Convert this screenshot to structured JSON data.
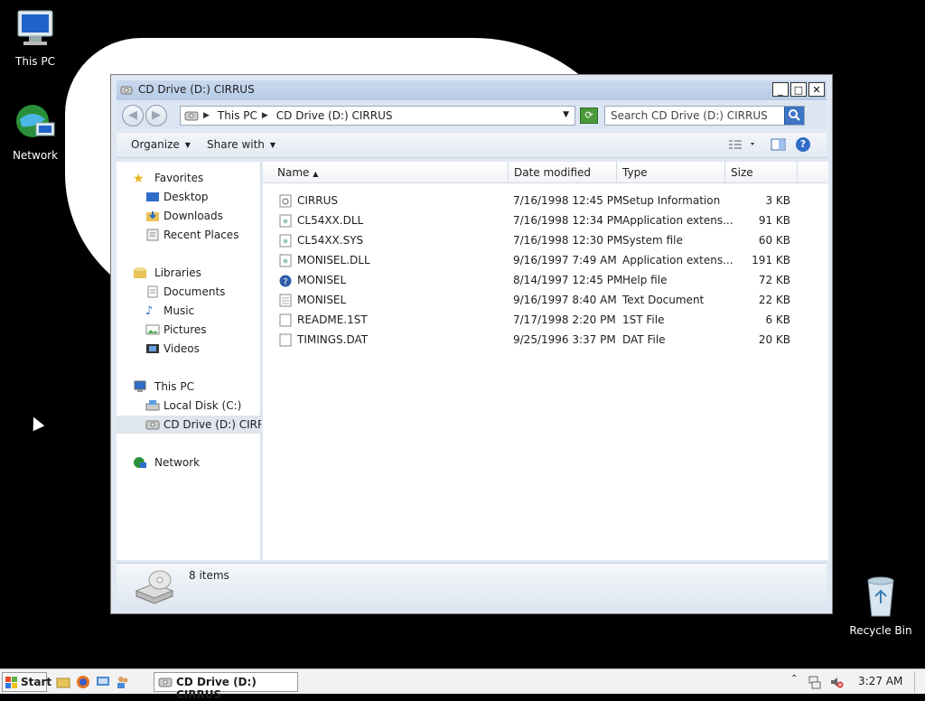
{
  "desktop": {
    "icons": [
      {
        "label": "This PC",
        "icon": "computer-icon"
      },
      {
        "label": "Network",
        "icon": "network-globe-icon"
      },
      {
        "label": "Recycle Bin",
        "icon": "recycle-bin-icon"
      }
    ]
  },
  "window": {
    "title": "CD Drive (D:) CIRRUS",
    "controls": {
      "minimize": "_",
      "maximize": "□",
      "close": "✕"
    },
    "address": {
      "crumbs": [
        "This PC",
        "CD Drive (D:) CIRRUS"
      ]
    },
    "search_placeholder": "Search CD Drive (D:) CIRRUS",
    "toolbar": {
      "organize": "Organize",
      "share_with": "Share with"
    },
    "nav": {
      "favorites": "Favorites",
      "favorites_items": [
        "Desktop",
        "Downloads",
        "Recent Places"
      ],
      "libraries": "Libraries",
      "libraries_items": [
        "Documents",
        "Music",
        "Pictures",
        "Videos"
      ],
      "thispc": "This PC",
      "thispc_items": [
        "Local Disk (C:)",
        "CD Drive (D:) CIRRUS"
      ],
      "network": "Network"
    },
    "columns": [
      "Name",
      "Date modified",
      "Type",
      "Size"
    ],
    "files": [
      {
        "name": "CIRRUS",
        "date": "7/16/1998 12:45 PM",
        "type": "Setup Information",
        "size": "3 KB",
        "icon": "settings-file-icon"
      },
      {
        "name": "CL54XX.DLL",
        "date": "7/16/1998 12:34 PM",
        "type": "Application extens...",
        "size": "91 KB",
        "icon": "dll-file-icon"
      },
      {
        "name": "CL54XX.SYS",
        "date": "7/16/1998 12:30 PM",
        "type": "System file",
        "size": "60 KB",
        "icon": "system-file-icon"
      },
      {
        "name": "MONISEL.DLL",
        "date": "9/16/1997 7:49 AM",
        "type": "Application extens...",
        "size": "191 KB",
        "icon": "dll-file-icon"
      },
      {
        "name": "MONISEL",
        "date": "8/14/1997 12:45 PM",
        "type": "Help file",
        "size": "72 KB",
        "icon": "help-file-icon"
      },
      {
        "name": "MONISEL",
        "date": "9/16/1997 8:40 AM",
        "type": "Text Document",
        "size": "22 KB",
        "icon": "text-file-icon"
      },
      {
        "name": "README.1ST",
        "date": "7/17/1998 2:20 PM",
        "type": "1ST File",
        "size": "6 KB",
        "icon": "blank-file-icon"
      },
      {
        "name": "TIMINGS.DAT",
        "date": "9/25/1996 3:37 PM",
        "type": "DAT File",
        "size": "20 KB",
        "icon": "blank-file-icon"
      }
    ],
    "status": {
      "count": "8 items"
    }
  },
  "taskbar": {
    "start": "Start",
    "task": "CD Drive (D:) CIRRUS",
    "clock": "3:27 AM"
  }
}
